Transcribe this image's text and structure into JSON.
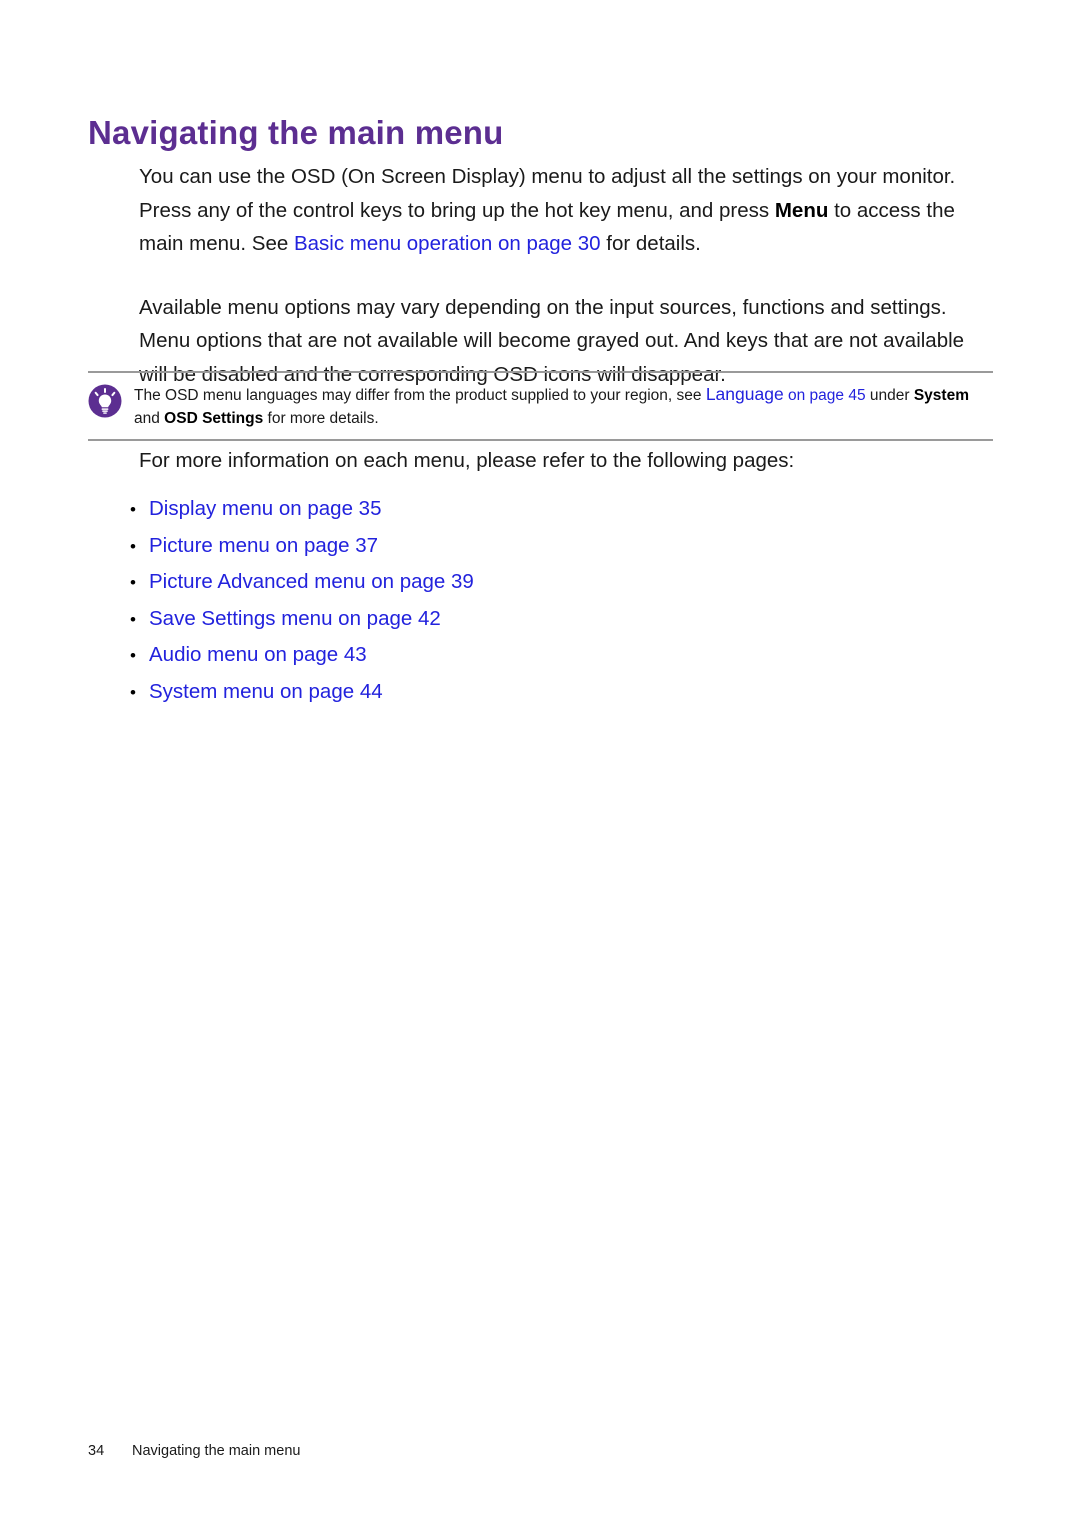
{
  "document": {
    "title": "Navigating the main menu",
    "colors": {
      "title_purple": "#5C2E91",
      "link_blue": "#2222DD",
      "rule_gray": "#9A9A9A",
      "body_black": "#1A1A1A"
    }
  },
  "paragraphs": {
    "p1": {
      "seg1": "You can use the OSD (On Screen Display) menu to adjust all the settings on your monitor. Press any of the control keys to bring up the hot key menu, and press ",
      "bold1": "Menu",
      "seg2": " to access the main menu. See ",
      "link1": "Basic menu operation on page 30",
      "seg3": " for details."
    },
    "p2": {
      "text": "Available menu options may vary depending on the input sources, functions and settings. Menu options that are not available will become grayed out. And keys that are not available will be disabled and the corresponding OSD icons will disappear."
    }
  },
  "note": {
    "icon": "lightbulb-icon",
    "seg1": "The OSD menu languages may differ from the product supplied to your region, see ",
    "link_main": "Language",
    "link_page": " on page 45",
    "seg2": " under ",
    "bold1": "System",
    "seg3": " and ",
    "bold2": "OSD Settings",
    "seg4": " for more details."
  },
  "list_intro": "For more information on each menu, please refer to the following pages:",
  "links": [
    {
      "bullet": "•",
      "label": "Display menu on page 35"
    },
    {
      "bullet": "•",
      "label": "Picture menu on page 37"
    },
    {
      "bullet": "•",
      "label": "Picture Advanced menu on page 39"
    },
    {
      "bullet": "•",
      "label": "Save Settings menu on page 42"
    },
    {
      "bullet": "•",
      "label": "Audio menu on page 43"
    },
    {
      "bullet": "•",
      "label": "System menu on page 44"
    }
  ],
  "footer": {
    "page_number": "34",
    "title": "Navigating the main menu"
  }
}
